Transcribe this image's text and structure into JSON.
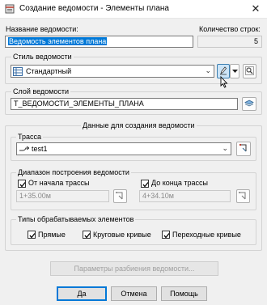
{
  "window": {
    "title": "Создание ведомости - Элементы плана",
    "close_glyph": "✕"
  },
  "name_section": {
    "name_label": "Название ведомости:",
    "name_value": "Ведомость элементов плана",
    "count_label": "Количество строк:",
    "count_value": "5"
  },
  "style_group": {
    "title": "Стиль ведомости",
    "selected": "Стандартный"
  },
  "layer_group": {
    "title": "Слой ведомости",
    "value": "Т_ВЕДОМОСТИ_ЭЛЕМЕНТЫ_ПЛАНА"
  },
  "data_group": {
    "title": "Данные для создания ведомости",
    "alignment": {
      "title": "Трасса",
      "selected": "test1"
    },
    "range": {
      "title": "Диапазон построения ведомости",
      "from_start_label": "От начала трассы",
      "from_start_checked": true,
      "from_value": "1+35.00м",
      "to_end_label": "До конца трассы",
      "to_end_checked": true,
      "to_value": "4+34.10м"
    },
    "types": {
      "title": "Типы обрабатываемых элементов",
      "straight_label": "Прямые",
      "straight_checked": true,
      "curves_label": "Круговые кривые",
      "curves_checked": true,
      "spirals_label": "Переходные кривые",
      "spirals_checked": true
    }
  },
  "split_button_label": "Параметры разбиения ведомости...",
  "footer": {
    "ok_label": "Да",
    "cancel_label": "Отмена",
    "help_label": "Помощь"
  },
  "colors": {
    "selection": "#0078d7",
    "active_button": "#cce4f7"
  }
}
